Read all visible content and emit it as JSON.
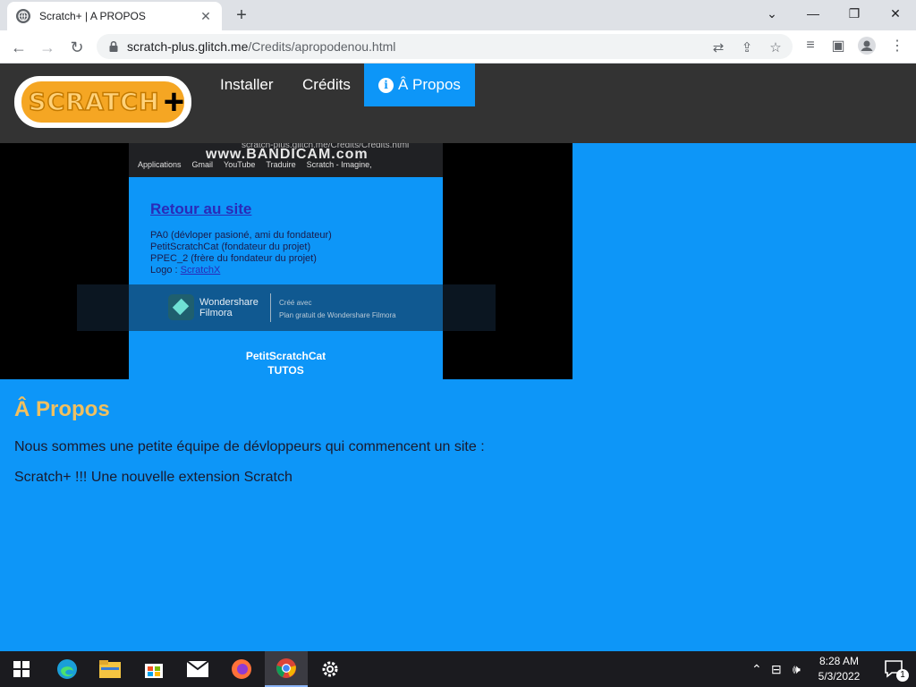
{
  "browser": {
    "tab_title": "Scratch+ | A PROPOS",
    "url_host": "scratch-plus.glitch.me",
    "url_path": "/Credits/apropodenou.html"
  },
  "site": {
    "logo_text": "SCRATCH",
    "logo_plus": "+",
    "nav": [
      {
        "label": "Installer"
      },
      {
        "label": "Crédits"
      },
      {
        "label": "Â Propos",
        "active": true
      }
    ]
  },
  "video": {
    "url_text": "scratch-plus.glitch.me/Credits/Credits.html",
    "watermark": "www.BANDICAM.com",
    "bookmarks": [
      "Applications",
      "Gmail",
      "YouTube",
      "Traduire",
      "Scratch - Imagine,"
    ],
    "link": "Retour au site",
    "lines": [
      "PA0 (dévloper pasioné, ami du fondateur)",
      "PetitScratchCat (fondateur du projet)",
      "PPEC_2 (frère du fondateur du projet)"
    ],
    "logo_label": "Logo :",
    "logo_link": "ScratchX",
    "filmora_name_1": "Wondershare",
    "filmora_name_2": "Filmora",
    "filmora_note_1": "Créé avec",
    "filmora_note_2": "Plan gratuit de Wondershare Filmora",
    "credit_1": "PetitScratchCat",
    "credit_2": "TUTOS"
  },
  "content": {
    "heading": "Â Propos",
    "paragraph_1": "Nous sommes une petite équipe de dévloppeurs qui commencent un site :",
    "paragraph_2": "Scratch+ !!! Une nouvelle extension Scratch"
  },
  "taskbar": {
    "time": "8:28 AM",
    "date": "5/3/2022",
    "notification_count": "1"
  }
}
